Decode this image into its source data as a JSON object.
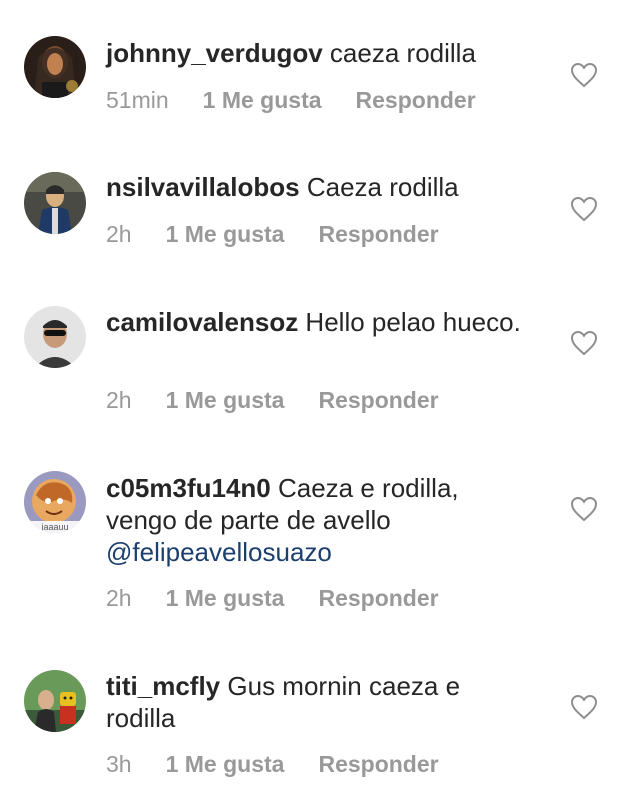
{
  "comments": [
    {
      "username": "johnny_verdugov",
      "text": " caeza rodilla",
      "mention": "",
      "time": "51min",
      "likes": "1 Me gusta",
      "reply": "Responder",
      "avatar_colors": [
        "#3a2a22",
        "#7a4a30",
        "#c08050"
      ]
    },
    {
      "username": "nsilvavillalobos",
      "text": " Caeza rodilla",
      "mention": "",
      "time": "2h",
      "likes": "1 Me gusta",
      "reply": "Responder",
      "avatar_colors": [
        "#3c4f6a",
        "#1f3a66",
        "#d8b080"
      ]
    },
    {
      "username": "camilovalensoz",
      "text": " Hello pelao hueco.",
      "mention": "",
      "time": "2h",
      "likes": "1 Me gusta",
      "reply": "Responder",
      "avatar_colors": [
        "#d9d9d9",
        "#c79a7a",
        "#222222"
      ]
    },
    {
      "username": "c05m3fu14n0",
      "text": " Caeza e rodilla, vengo de parte de avello ",
      "mention": "@felipeavellosuazo",
      "time": "2h",
      "likes": "1 Me gusta",
      "reply": "Responder",
      "avatar_colors": [
        "#e8a860",
        "#c06828",
        "#8a8ab0"
      ]
    },
    {
      "username": "titi_mcfly",
      "text": " Gus mornin caeza e rodilla",
      "mention": "",
      "time": "3h",
      "likes": "1 Me gusta",
      "reply": "Responder",
      "avatar_colors": [
        "#4a8a4a",
        "#e8c020",
        "#c83020"
      ]
    }
  ],
  "avatar_watermark": "jaaauu",
  "colors": {
    "text": "#262626",
    "meta": "#999999",
    "mention": "#1c3f6e",
    "heart": "#8e8e8e"
  }
}
